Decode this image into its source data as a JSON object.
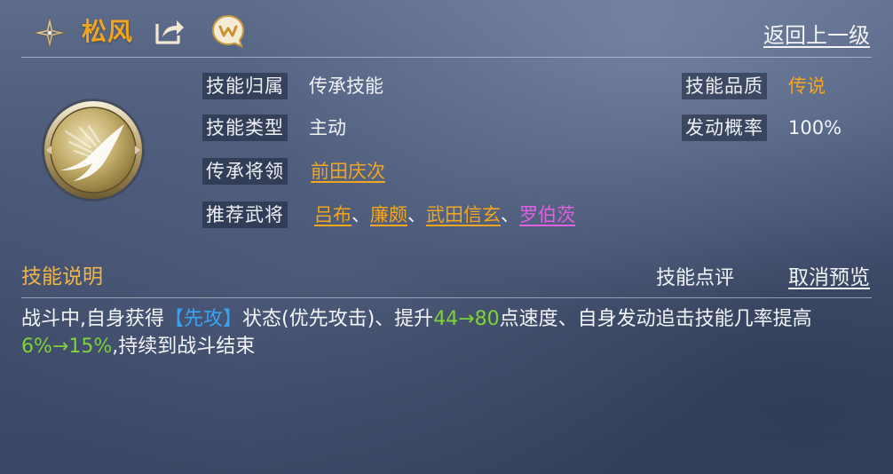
{
  "header": {
    "skill_name": "松风",
    "back_label": "返回上一级"
  },
  "info": {
    "belong_label": "技能归属",
    "belong_value": "传承技能",
    "type_label": "技能类型",
    "type_value": "主动",
    "inherit_label": "传承将领",
    "inherit_value": "前田庆次",
    "recommend_label": "推荐武将",
    "recommend_generals": [
      "吕布",
      "廉颇",
      "武田信玄",
      "罗伯茨"
    ],
    "separator": "、",
    "quality_label": "技能品质",
    "quality_value": "传说",
    "rate_label": "发动概率",
    "rate_value": "100%"
  },
  "description": {
    "title": "技能说明",
    "review_label": "技能点评",
    "cancel_preview_label": "取消预览",
    "part1": "战斗中,自身获得",
    "status": "【先攻】",
    "part2": "状态(优先攻击)、提升",
    "speed_change": "44→80",
    "part3": "点速度、自身发动追击技能几率提高",
    "chance_change": "6%→15%",
    "part4": ",持续到战斗结束"
  },
  "colors": {
    "accent_orange": "#f3a51e",
    "highlight_green": "#7ed23a",
    "status_blue": "#39a3f3",
    "rare_purple": "#e35fe3"
  },
  "icons": {
    "star": "compass-star-icon",
    "share": "share-icon",
    "chat": "chat-bubble-icon",
    "emblem": "swallow-skill-emblem"
  }
}
